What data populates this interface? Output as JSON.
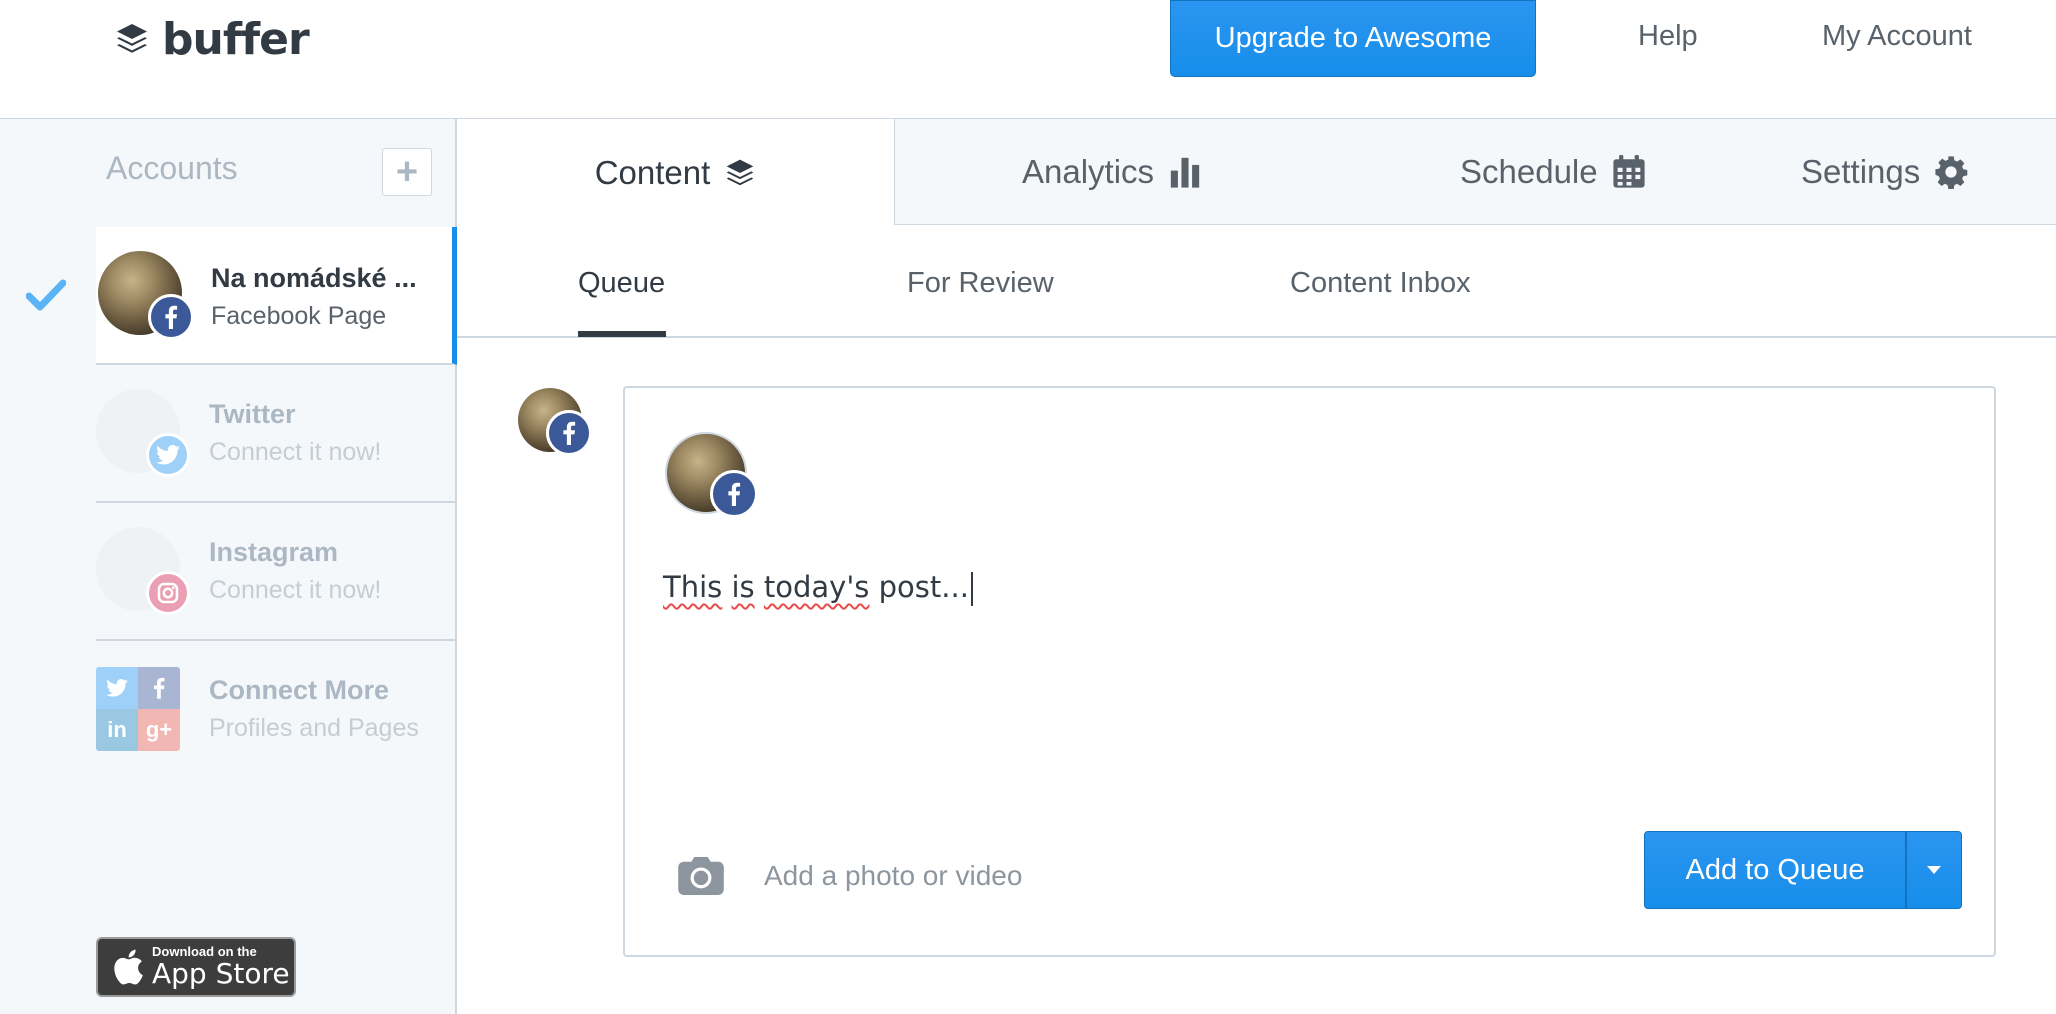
{
  "header": {
    "logo_text": "buffer",
    "upgrade_label": "Upgrade to Awesome",
    "help_label": "Help",
    "account_label": "My Account"
  },
  "sidebar": {
    "accounts_heading": "Accounts",
    "accounts": [
      {
        "name": "Na nomádské ...",
        "type": "Facebook Page",
        "network": "facebook",
        "selected": true
      },
      {
        "name": "Twitter",
        "type": "Connect it now!",
        "network": "twitter",
        "selected": false
      },
      {
        "name": "Instagram",
        "type": "Connect it now!",
        "network": "instagram",
        "selected": false
      },
      {
        "name": "Connect More",
        "type": "Profiles and Pages",
        "network": "multi",
        "selected": false
      }
    ],
    "appstore": {
      "small": "Download on the",
      "big": "App Store"
    }
  },
  "tabs": [
    {
      "label": "Content",
      "icon": "layers-icon",
      "active": true
    },
    {
      "label": "Analytics",
      "icon": "bar-chart-icon",
      "active": false
    },
    {
      "label": "Schedule",
      "icon": "calendar-icon",
      "active": false
    },
    {
      "label": "Settings",
      "icon": "gear-icon",
      "active": false
    }
  ],
  "subtabs": [
    {
      "label": "Queue",
      "active": true
    },
    {
      "label": "For Review",
      "active": false
    },
    {
      "label": "Content Inbox",
      "active": false
    }
  ],
  "composer": {
    "post_words": [
      "This",
      "is",
      "today's",
      "post..."
    ],
    "photo_placeholder": "Add a photo or video",
    "submit_label": "Add to Queue"
  },
  "colors": {
    "accent": "#168eea",
    "facebook": "#3b5998",
    "twitter": "#55acee",
    "instagram": "#e1306c",
    "sidebar_bg": "#f5f8fb",
    "border": "#ced7df"
  }
}
